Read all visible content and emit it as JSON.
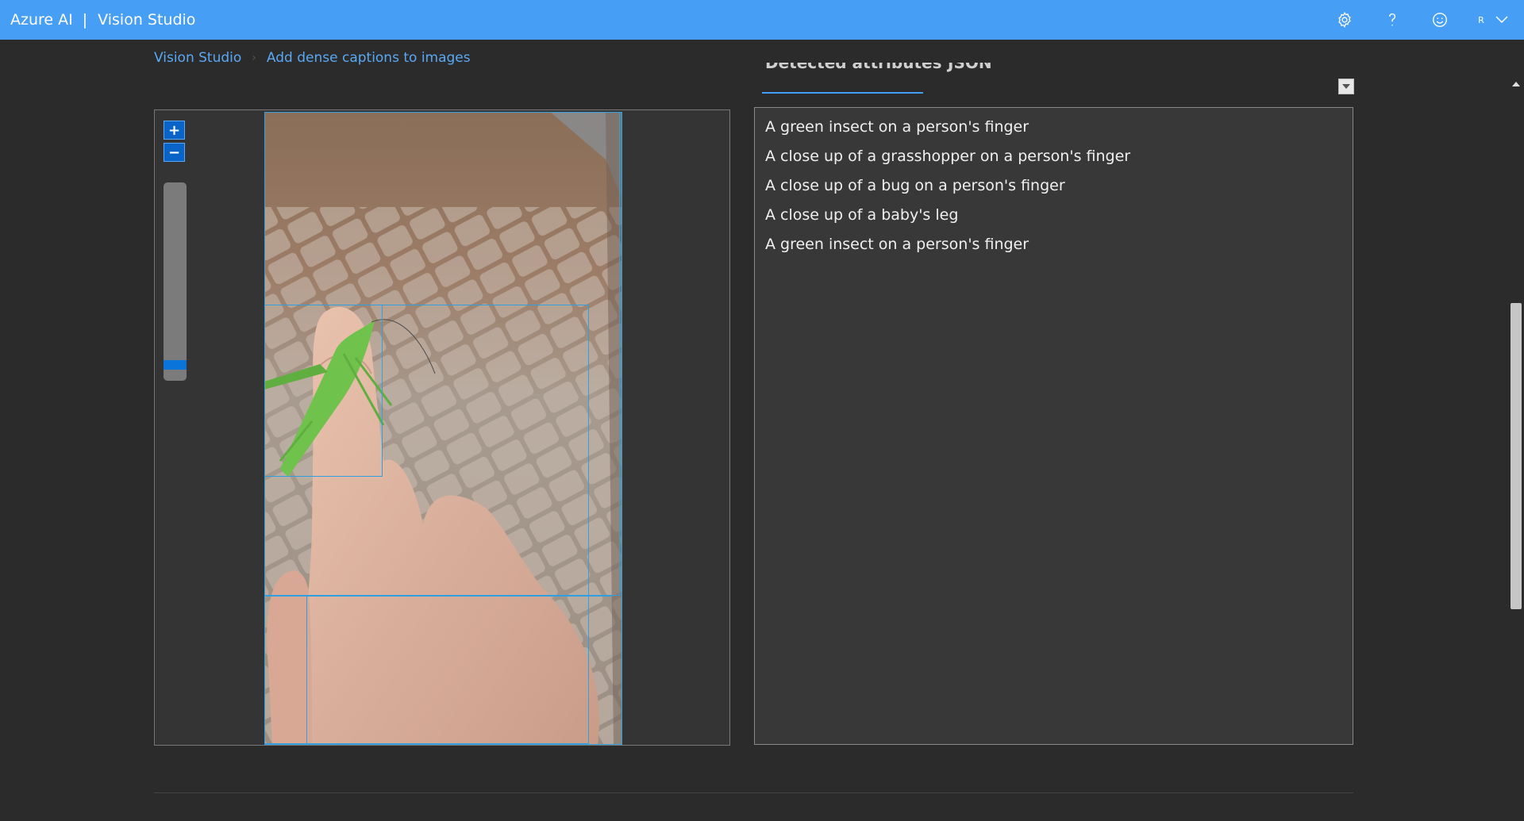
{
  "header": {
    "brand": "Azure AI",
    "separator": "|",
    "product": "Vision Studio",
    "user_initial": "R"
  },
  "breadcrumb": {
    "home": "Vision Studio",
    "current": "Add dense captions to images"
  },
  "tabs": [
    {
      "label": "Detected attributes"
    },
    {
      "label": "JSON"
    }
  ],
  "viewer": {
    "zoom_in_label": "+",
    "zoom_out_label": "−",
    "zoom_level": 0.06
  },
  "captions": [
    "A green insect on a person's finger",
    "A close up of a grasshopper on a person's finger",
    "A close up of a bug on a person's finger",
    "A close up of a baby's leg",
    "A green insect on a person's finger"
  ],
  "colors": {
    "topbar": "#479ef5",
    "accent": "#0a64c8",
    "link": "#5aa8f3",
    "bbox": "#2f9fe0",
    "background": "#2b2b2b"
  }
}
